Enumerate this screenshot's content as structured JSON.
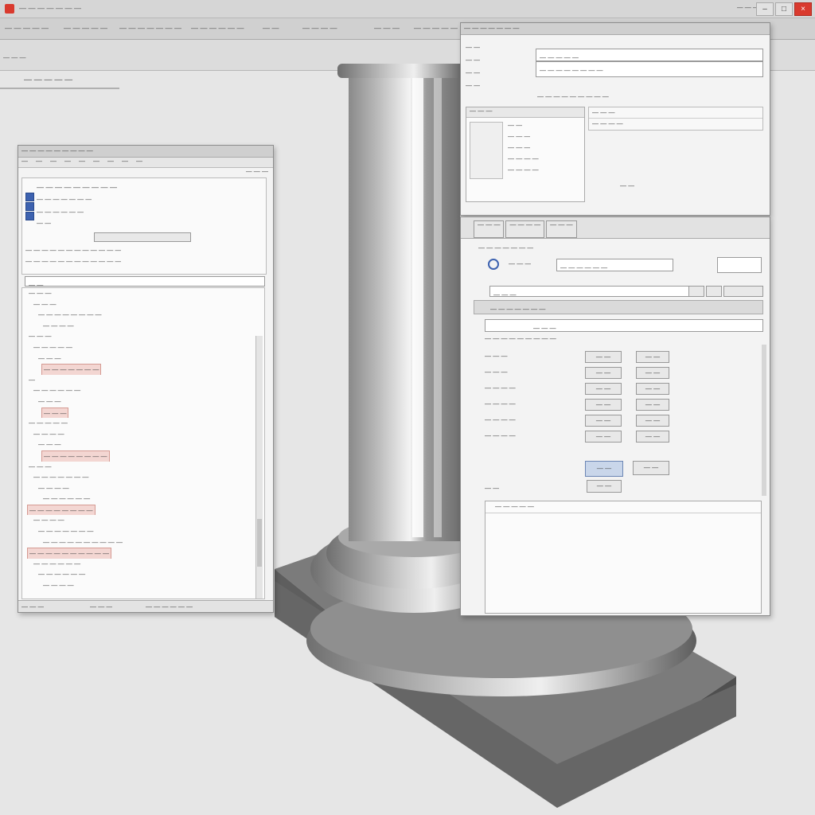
{
  "titlebar": {
    "title": "— — — — — — —",
    "minimize": "–",
    "maximize": "□",
    "close": "×",
    "right_text": "— — —"
  },
  "toolbar": {
    "items": [
      "— — — — —",
      "— — — — —",
      "— — — — — — —",
      "— — — — — —",
      "— —",
      "— — — —",
      "— — —",
      "— — — — —"
    ]
  },
  "subbar": {
    "label": "— — —"
  },
  "viewport": {
    "label": "— — — — —"
  },
  "left_window": {
    "title": "— — — — — — — — —",
    "menu": [
      "—",
      "—",
      "—",
      "—",
      "—",
      "—",
      "—",
      "—",
      "—"
    ],
    "header_right": "— — —",
    "content_title": "— — — — — — — — —",
    "content_lines": [
      "— — — — — — —",
      "— — — — — —",
      "— —"
    ],
    "path_line": "— — — — — — — — — — — —",
    "filter_line": "— — — — — — — — — — — —",
    "field_label": "— —",
    "tree": [
      "— — —",
      "— — —",
      "— — — — — — — —",
      "— — — —",
      "— — —",
      "— — — — —",
      "— — —",
      "— — — — — — —",
      "—",
      "— — — — — —",
      "— — —",
      "— — —",
      "— — — — —",
      "— — — —",
      "— — —",
      "— — — — — — — —",
      "— — —",
      "— — — — — — —",
      "— — — —",
      "— — — — — —",
      "— — — — — — — —",
      "— — — —",
      "— — — — — — —",
      "— — — — — — — — — —",
      "— — — — — — — — — —",
      "— — — — — —",
      "— — — — — —",
      "— — — —"
    ],
    "status_left": "— — —",
    "status_mid": "— — —",
    "status_right": "— — — — — —"
  },
  "dialog_top": {
    "title": "— — — — — — —",
    "left_labels": [
      "— —",
      "— —",
      "— —",
      "— —"
    ],
    "input_value": "— — — — —",
    "input_sub": "— — — — — — — —",
    "description": "— — — — — — — — —",
    "list_header": "— — —",
    "list_items": [
      "— —",
      "— — —",
      "— — —",
      "— — — —",
      "— — — —"
    ],
    "right_rows": [
      "— — —",
      "— — — —"
    ],
    "footer_text": "— —"
  },
  "dialog_bottom": {
    "tabs": [
      "— — —",
      "— — — —",
      "— — —"
    ],
    "path": "— — — — — — —",
    "lookup_label": "— — —",
    "lookup_value": "— — — — — —",
    "section_label": "— — —",
    "filter_text": "— — — — — — —",
    "group_label": "— — — — — — — — —",
    "group_value": "— — —",
    "rows": [
      {
        "label": "— — —",
        "value": "— —",
        "extra": "— —"
      },
      {
        "label": "— — —",
        "value": "— —",
        "extra": "— —"
      },
      {
        "label": "— — — —",
        "value": "— —",
        "extra": "— —"
      },
      {
        "label": "— — — —",
        "value": "— —",
        "extra": "— —"
      },
      {
        "label": "— — — —",
        "value": "— —",
        "extra": "— —"
      },
      {
        "label": "— — — —",
        "value": "— —",
        "extra": "— —"
      }
    ],
    "ok_label": "— —",
    "cancel_label": "— —",
    "small_button": "— —",
    "footer_label": "— —",
    "list_label": "— — — — —"
  }
}
